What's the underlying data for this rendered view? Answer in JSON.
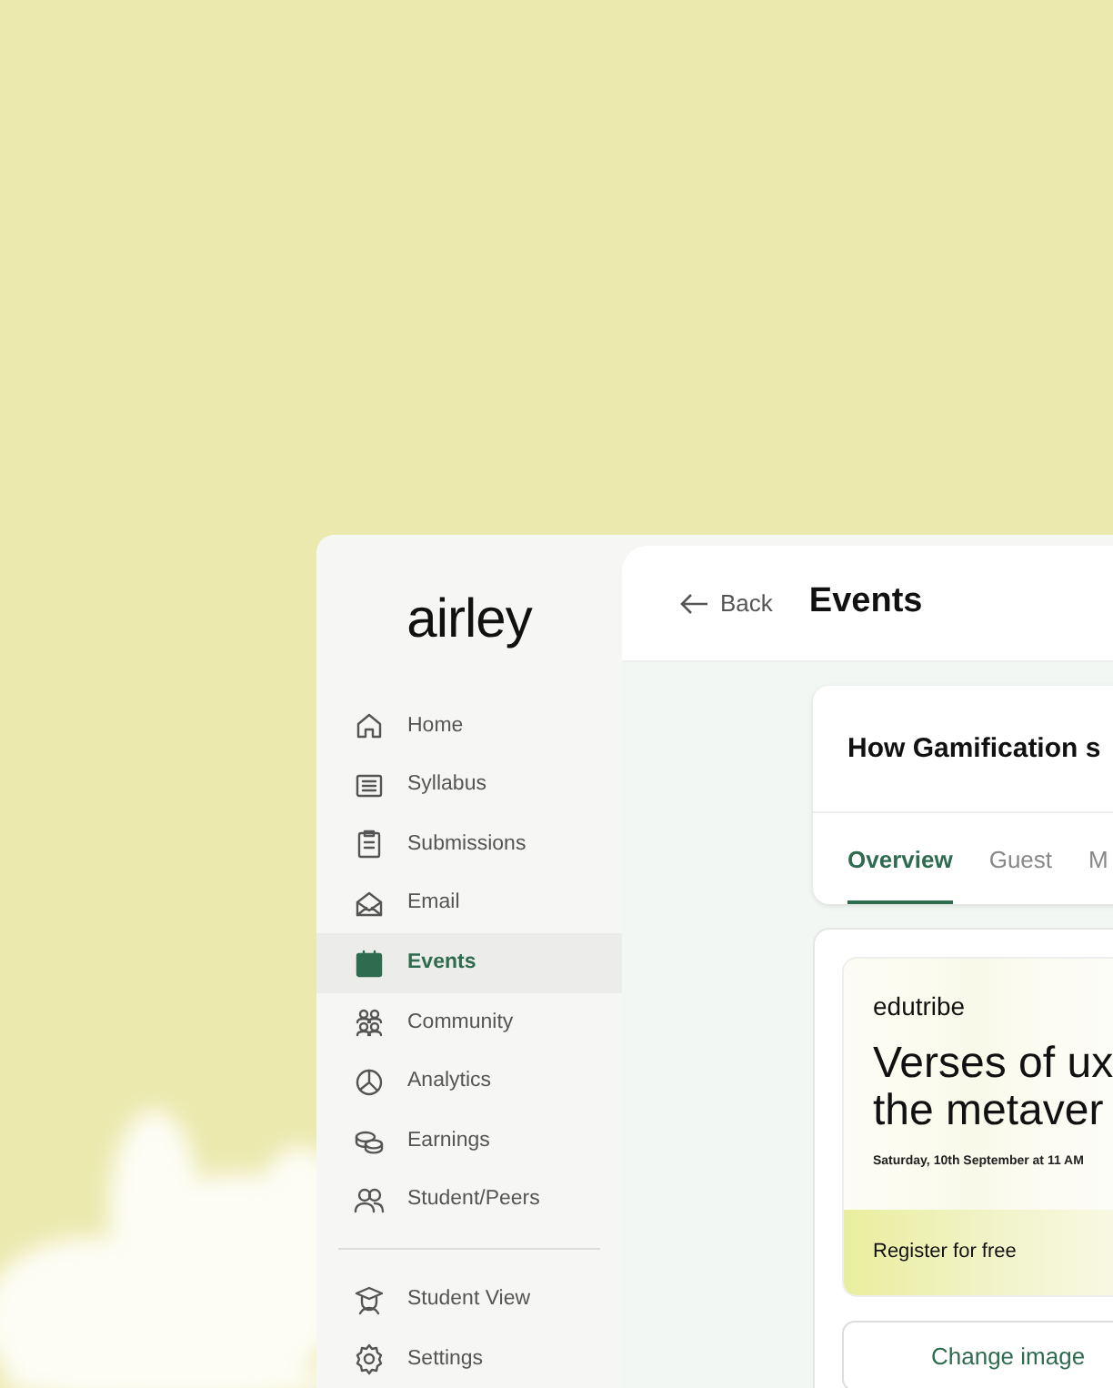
{
  "logo": "airley",
  "sidebar": {
    "items": [
      {
        "label": "Home",
        "selected": false
      },
      {
        "label": "Syllabus",
        "selected": false
      },
      {
        "label": "Submissions",
        "selected": false
      },
      {
        "label": "Email",
        "selected": false
      },
      {
        "label": "Events",
        "selected": true
      },
      {
        "label": "Community",
        "selected": false
      },
      {
        "label": "Analytics",
        "selected": false
      },
      {
        "label": "Earnings",
        "selected": false
      },
      {
        "label": "Student/Peers",
        "selected": false
      }
    ],
    "footer_items": [
      {
        "label": "Student View",
        "selected": false
      },
      {
        "label": "Settings",
        "selected": false
      }
    ]
  },
  "header": {
    "back": "Back",
    "title": "Events"
  },
  "event_card": {
    "title": "How Gamification s",
    "tabs": [
      {
        "label": "Overview",
        "selected": true
      },
      {
        "label": "Guest",
        "selected": false
      },
      {
        "label": "M",
        "selected": false
      }
    ]
  },
  "banner": {
    "brand": "edutribe",
    "headline": [
      "Verses of ux",
      "the metaver"
    ],
    "date": "Saturday, 10th September at 11 AM",
    "cta": "Register for free"
  },
  "change_image": "Change image"
}
